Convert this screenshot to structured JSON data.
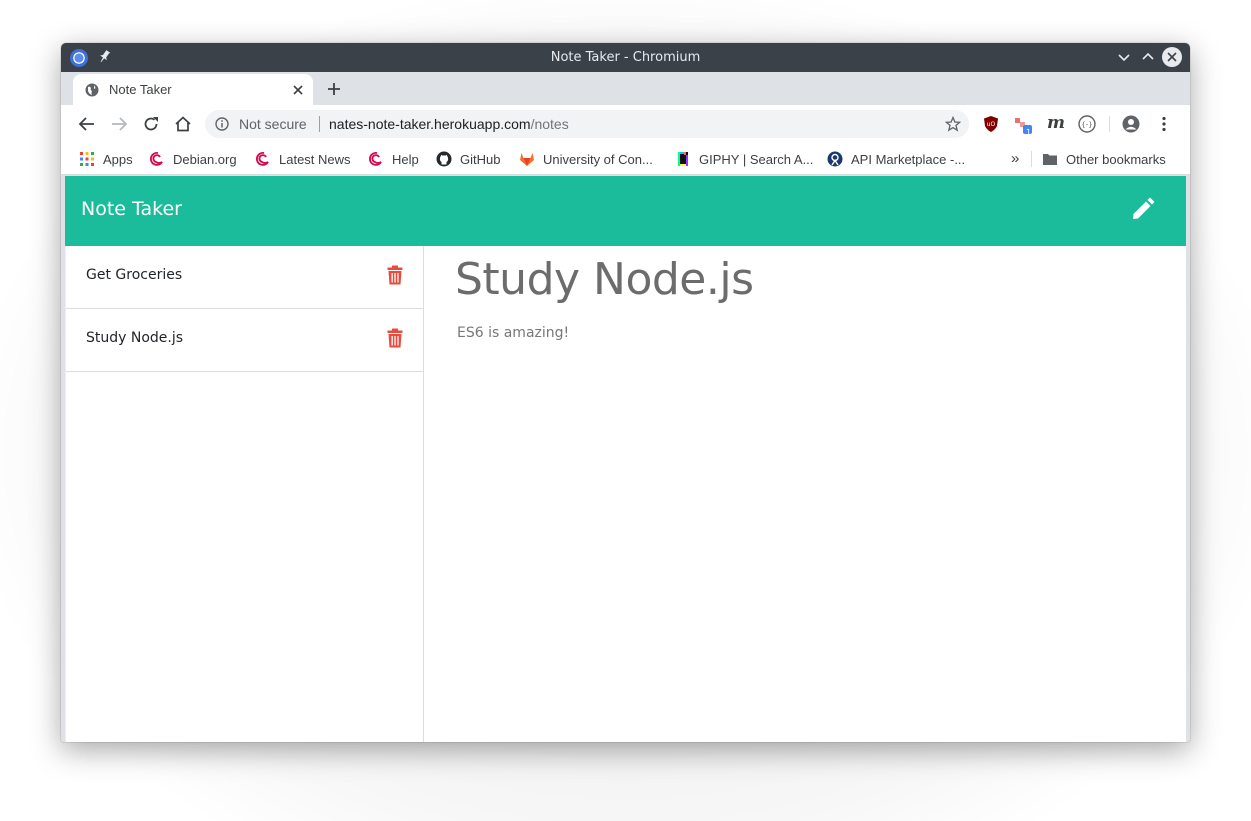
{
  "window": {
    "title": "Note Taker - Chromium"
  },
  "tab": {
    "title": "Note Taker"
  },
  "omnibox": {
    "security": "Not secure",
    "host": "nates-note-taker.herokuapp.com",
    "path": "/notes"
  },
  "bookmarks": {
    "items": [
      {
        "label": "Apps",
        "icon": "apps-grid-icon"
      },
      {
        "label": "Debian.org",
        "icon": "debian-icon"
      },
      {
        "label": "Latest News",
        "icon": "debian-icon"
      },
      {
        "label": "Help",
        "icon": "debian-icon"
      },
      {
        "label": "GitHub",
        "icon": "github-icon"
      },
      {
        "label": "University of Con...",
        "icon": "gitlab-icon"
      },
      {
        "label": "GIPHY | Search A...",
        "icon": "giphy-icon"
      },
      {
        "label": "API Marketplace -...",
        "icon": "rapidapi-icon"
      }
    ],
    "overflow": "»",
    "other": "Other bookmarks"
  },
  "extensions": {
    "badge_count": "1",
    "m_label": "m"
  },
  "app": {
    "brand": "Note Taker",
    "accent_color": "#1abc9c",
    "trash_color": "#e74c3c"
  },
  "notes": [
    {
      "title": "Get Groceries"
    },
    {
      "title": "Study Node.js"
    }
  ],
  "active_note": {
    "title": "Study Node.js",
    "text": "ES6 is amazing!"
  }
}
